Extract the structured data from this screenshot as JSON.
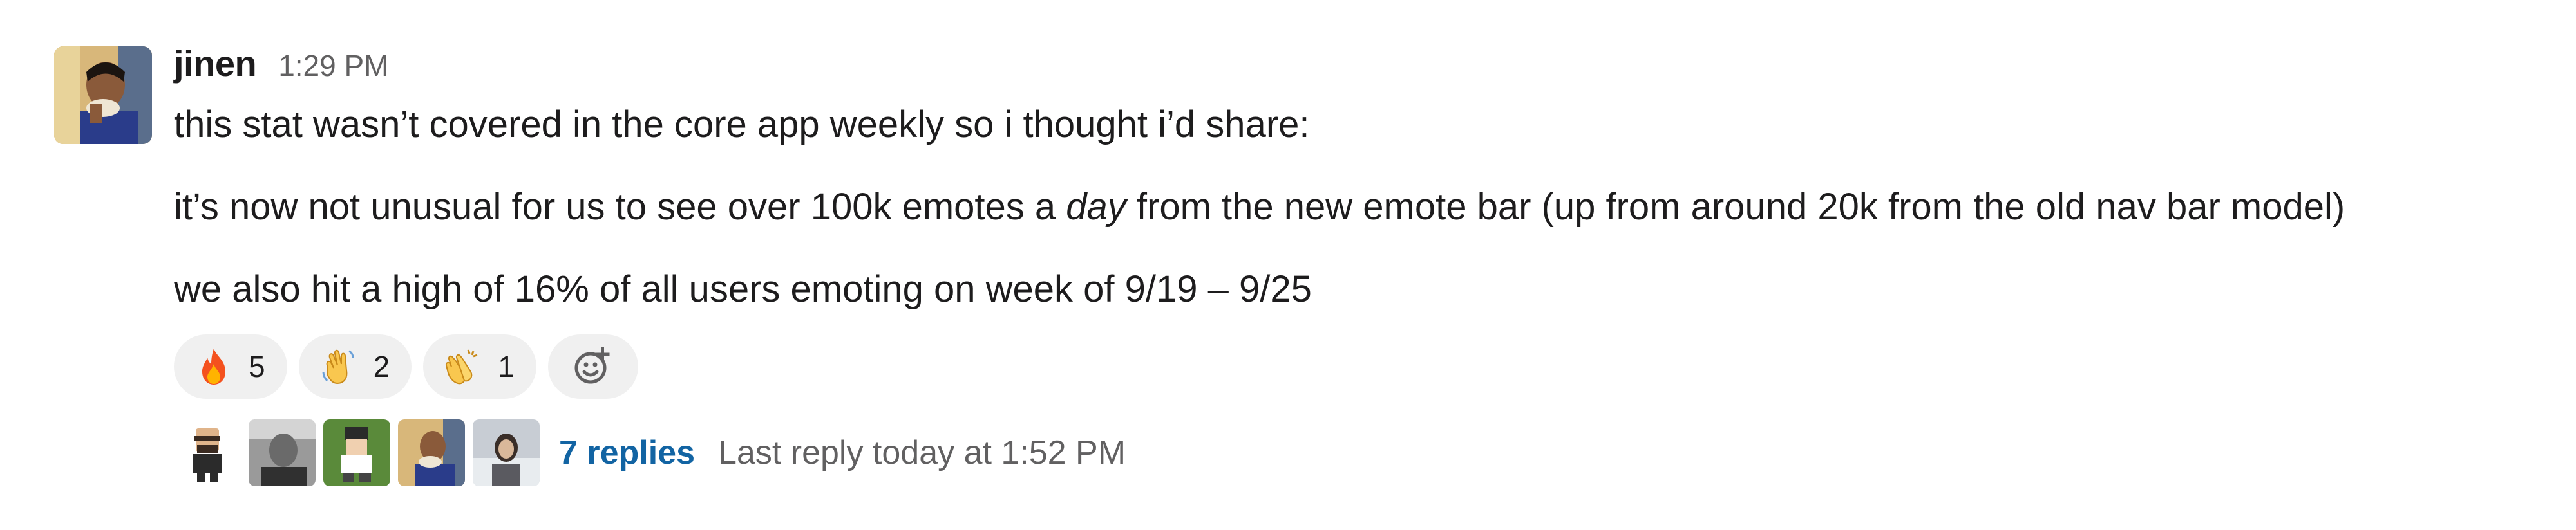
{
  "message": {
    "author": "jinen",
    "timestamp": "1:29 PM",
    "lines": {
      "l1": "this stat wasn’t covered in the core app weekly so i thought i’d share:",
      "l2_pre": "it’s now not unusual for us to see over 100k emotes a ",
      "l2_em": "day",
      "l2_post": " from the new emote bar (up from around 20k from the old nav bar model)",
      "l3": "we also hit a high of 16% of all users emoting on week of 9/19 – 9/25"
    }
  },
  "reactions": [
    {
      "icon": "fire-emoji",
      "count": "5"
    },
    {
      "icon": "wave-emoji",
      "count": "2"
    },
    {
      "icon": "clap-emoji",
      "count": "1"
    }
  ],
  "add_reaction_icon": "add-reaction-icon",
  "thread": {
    "replies": "7 replies",
    "last_reply": "Last reply today at 1:52 PM"
  },
  "colors": {
    "link": "#1264a3",
    "muted": "#616061",
    "text": "#1d1c1d",
    "reaction_bg": "#f0f0f0"
  }
}
